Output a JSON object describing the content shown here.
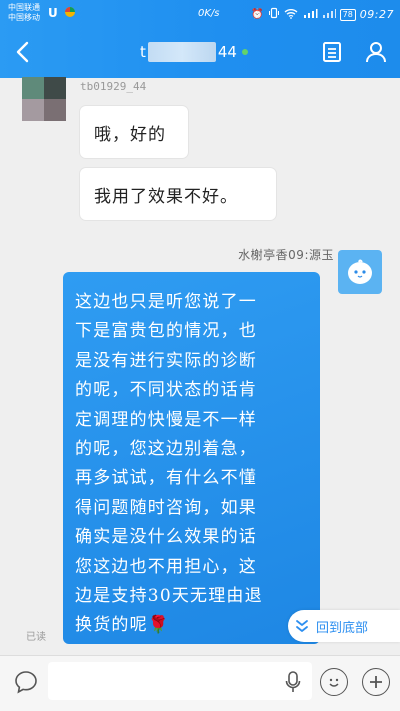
{
  "status_bar": {
    "carrier_1": "中国联通",
    "carrier_2": "中国移动",
    "net_speed": "0K/s",
    "battery": "78",
    "time": "09:27"
  },
  "header": {
    "title_prefix": "t",
    "title_suffix": "44",
    "back_icon": "back-arrow-icon",
    "doc_icon": "document-icon",
    "user_icon": "user-icon"
  },
  "messages": [
    {
      "sender": "tb01929_44",
      "side": "left",
      "text": "哦，好的"
    },
    {
      "sender": "tb01929_44",
      "side": "left",
      "text": "我用了效果不好。"
    },
    {
      "sender": "水榭亭香09:源玉",
      "side": "right",
      "lines": [
        "这边也只是听您说了一",
        "下是富贵包的情况，也",
        "是没有进行实际的诊断",
        "的呢，不同状态的话肯",
        "定调理的快慢是不一样",
        "的呢，您这边别着急，",
        "再多试试，有什么不懂",
        "得问题随时咨询，如果",
        "确实是没什么效果的话",
        "您这边也不用担心，这",
        "边是支持30天无理由退",
        "换货的呢🌹"
      ]
    }
  ],
  "read_status": "已读",
  "back_to_bottom": "回到底部",
  "input": {
    "placeholder": ""
  },
  "colors": {
    "header": "#1f8ff0",
    "bubble_right": "#2b95ee",
    "accent": "#2d8ff0"
  }
}
